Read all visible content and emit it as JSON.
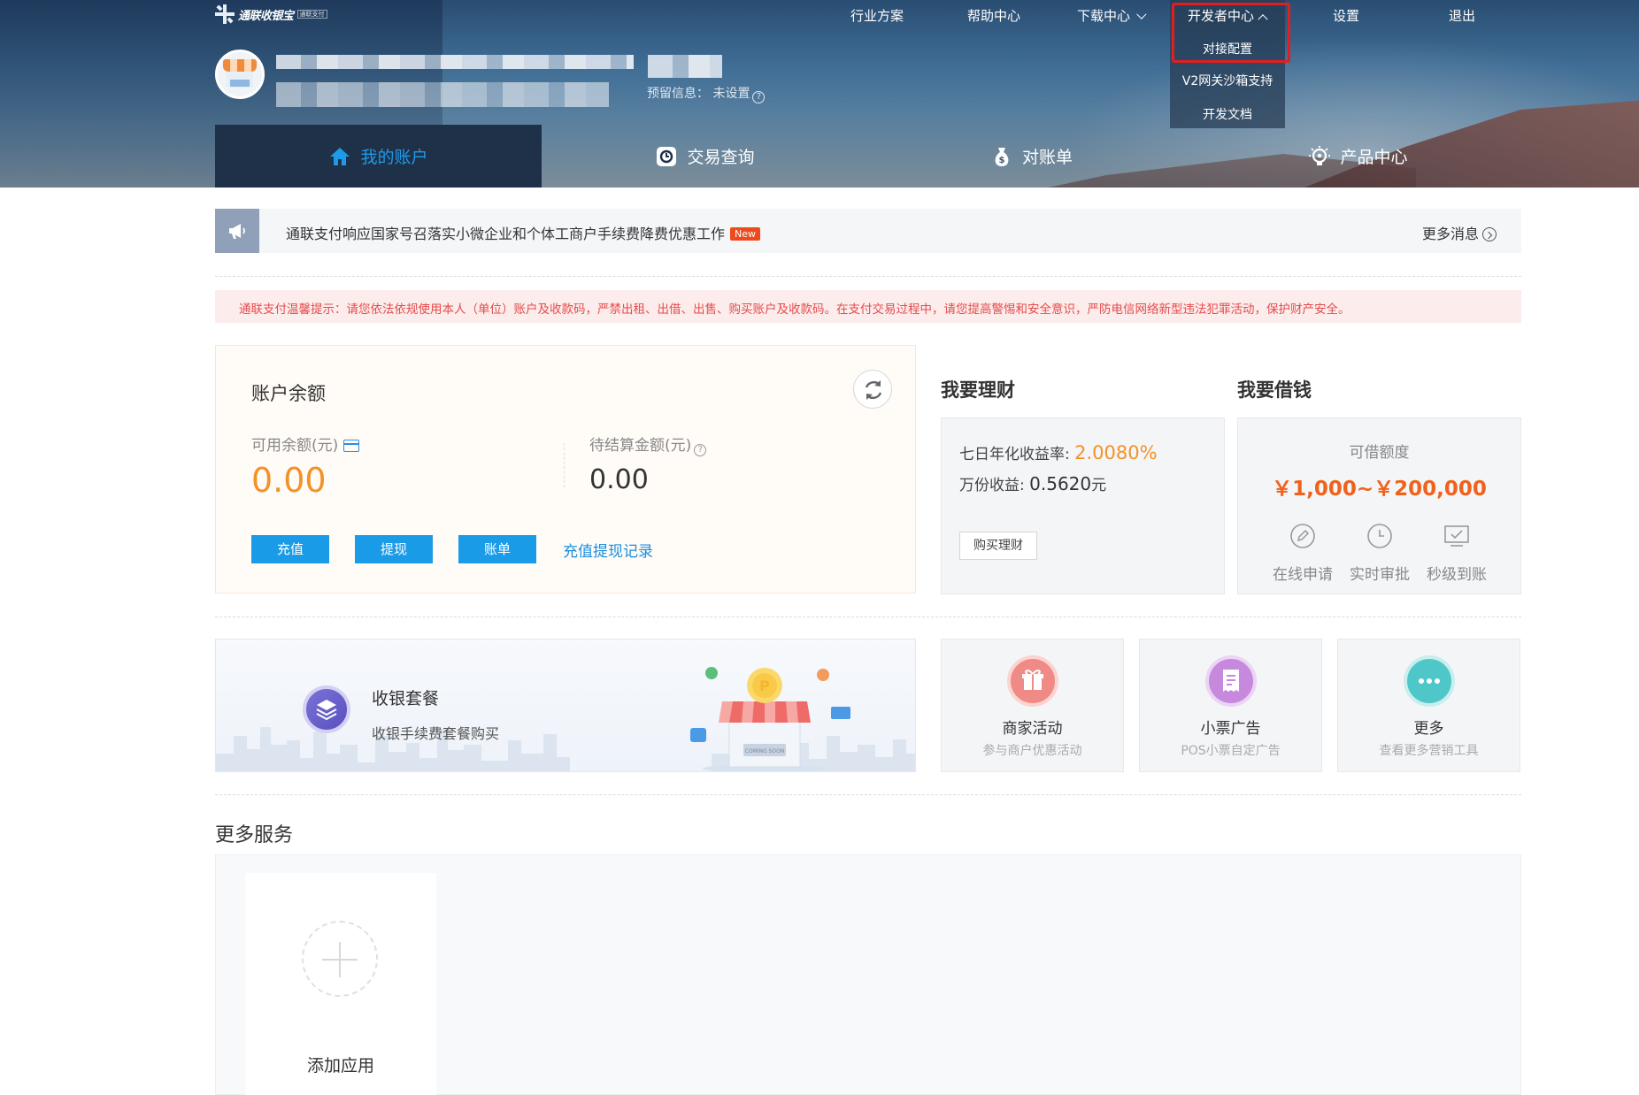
{
  "header": {
    "logo_text": "通联收银宝",
    "logo_sub": "通联支付",
    "reserve_label": "预留信息：",
    "reserve_value": "未设置"
  },
  "topnav": {
    "industry": "行业方案",
    "help": "帮助中心",
    "download": "下载中心",
    "developer": "开发者中心",
    "settings": "设置",
    "logout": "退出"
  },
  "devmenu": {
    "items": [
      "对接配置",
      "V2网关沙箱支持",
      "开发文档"
    ]
  },
  "mainnav": {
    "tabs": [
      {
        "label": "我的账户",
        "icon": "home-icon"
      },
      {
        "label": "交易查询",
        "icon": "search-icon"
      },
      {
        "label": "对账单",
        "icon": "money-bag-icon"
      },
      {
        "label": "产品中心",
        "icon": "lightbulb-icon"
      }
    ],
    "active": "我的账户"
  },
  "notice": {
    "message": "通联支付响应国家号召落实小微企业和个体工商户手续费降费优惠工作",
    "badge": "New",
    "more": "更多消息"
  },
  "warning": {
    "text": "通联支付温馨提示：请您依法依规使用本人（单位）账户及收款码，严禁出租、出借、出售、购买账户及收款码。在支付交易过程中，请您提高警惕和安全意识，严防电信网络新型违法犯罪活动，保护财产安全。"
  },
  "balance": {
    "title": "账户余额",
    "available_label": "可用余额(元)",
    "available_value": "0.00",
    "pending_label": "待结算金额(元)",
    "pending_value": "0.00",
    "recharge": "充值",
    "withdraw": "提现",
    "bill": "账单",
    "records": "充值提现记录"
  },
  "finance": {
    "title": "我要理财",
    "rate_label": "七日年化收益率:",
    "rate_value": "2.0080%",
    "wan_label": "万份收益:",
    "wan_value": "0.5620",
    "wan_unit": "元",
    "buy": "购买理财"
  },
  "loan": {
    "title": "我要借钱",
    "label": "可借额度",
    "range": "￥1,000~￥200,000",
    "steps": [
      "在线申请",
      "实时审批",
      "秒级到账"
    ]
  },
  "promo": {
    "title": "收银套餐",
    "subtitle": "收银手续费套餐购买",
    "sign": "COMING SOON"
  },
  "marketing": [
    {
      "title": "商家活动",
      "subtitle": "参与商户优惠活动",
      "color": "#f08a86"
    },
    {
      "title": "小票广告",
      "subtitle": "POS小票自定广告",
      "color": "#c789dd"
    },
    {
      "title": "更多",
      "subtitle": "查看更多营销工具",
      "color": "#4fc7c9"
    }
  ],
  "services": {
    "title": "更多服务",
    "add": "添加应用"
  }
}
